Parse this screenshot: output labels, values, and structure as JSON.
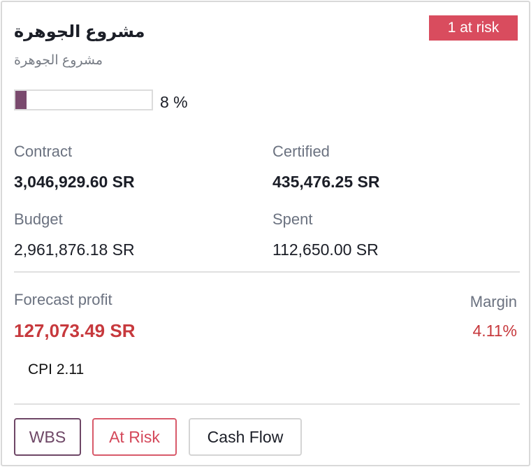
{
  "project": {
    "title": "مشروع الجوهرة",
    "subtitle": "مشروع الجوهرة",
    "risk_badge": "1 at risk"
  },
  "progress": {
    "value": 8,
    "label": "8 %"
  },
  "metrics": {
    "contract": {
      "label": "Contract",
      "value": "3,046,929.60 SR"
    },
    "certified": {
      "label": "Certified",
      "value": "435,476.25 SR"
    },
    "budget": {
      "label": "Budget",
      "value": "2,961,876.18 SR"
    },
    "spent": {
      "label": "Spent",
      "value": "112,650.00 SR"
    }
  },
  "forecast": {
    "label": "Forecast profit",
    "value": "127,073.49 SR",
    "margin_label": "Margin",
    "margin_value": "4.11%",
    "cpi": "CPI 2.11"
  },
  "actions": {
    "wbs": "WBS",
    "at_risk": "At Risk",
    "cash_flow": "Cash Flow"
  },
  "colors": {
    "accent": "#7a4a6e",
    "danger": "#d94c5e",
    "profit": "#c7393d"
  }
}
